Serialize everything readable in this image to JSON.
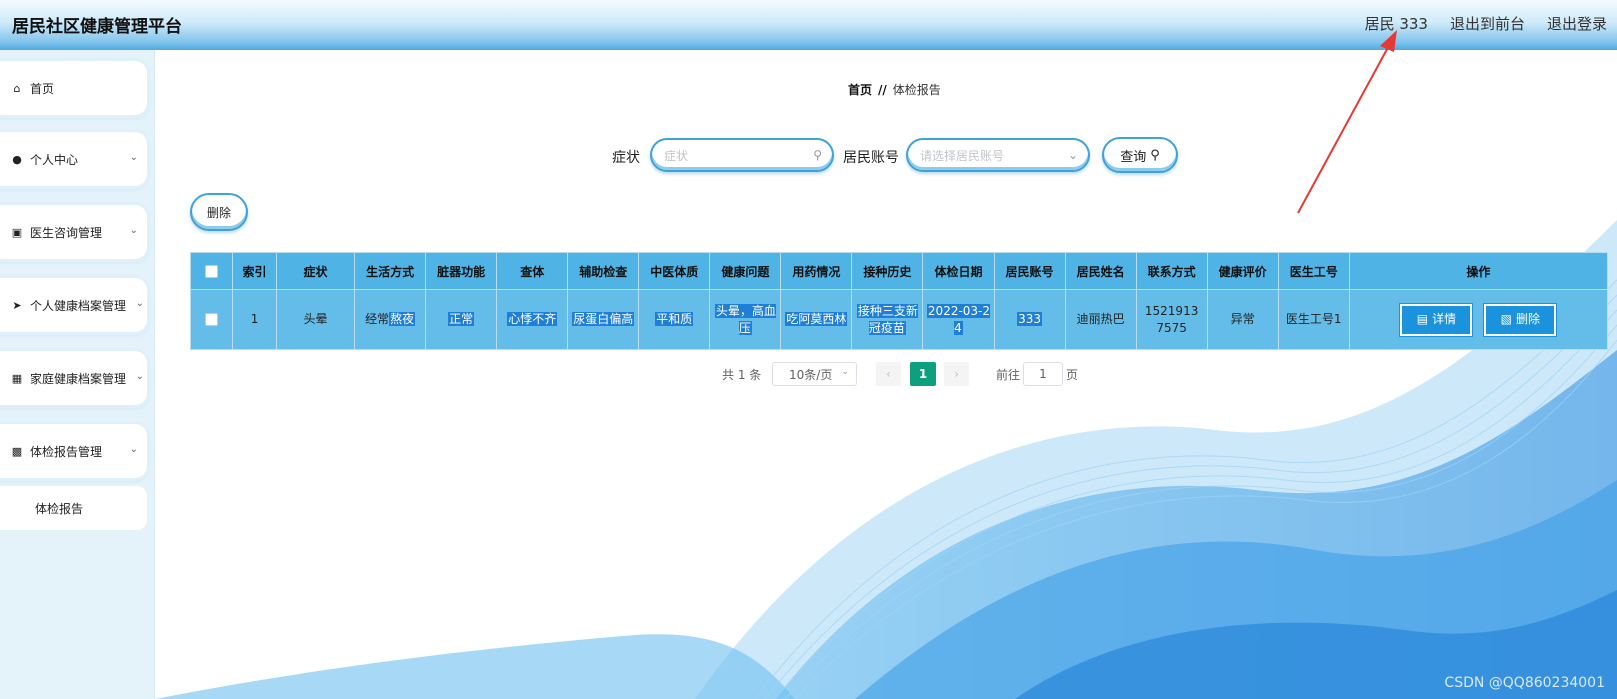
{
  "header": {
    "title": "居民社区健康管理平台",
    "user": "居民 333",
    "to_front": "退出到前台",
    "logout": "退出登录"
  },
  "sidebar": {
    "items": [
      {
        "label": "首页",
        "icon": "home-icon"
      },
      {
        "label": "个人中心",
        "icon": "user-icon"
      },
      {
        "label": "医生咨询管理",
        "icon": "monitor-icon"
      },
      {
        "label": "个人健康档案管理",
        "icon": "send-icon"
      },
      {
        "label": "家庭健康档案管理",
        "icon": "bar-chart-icon"
      },
      {
        "label": "体检报告管理",
        "icon": "grid-icon"
      }
    ],
    "subitem": "体检报告"
  },
  "breadcrumb": {
    "home": "首页",
    "sep": "//",
    "current": "体检报告"
  },
  "search": {
    "symptom_label": "症状",
    "symptom_placeholder": "症状",
    "account_label": "居民账号",
    "account_placeholder": "请选择居民账号",
    "query_label": "查询"
  },
  "toolbar": {
    "delete_label": "删除"
  },
  "table": {
    "headers": [
      "索引",
      "症状",
      "生活方式",
      "脏器功能",
      "查体",
      "辅助检查",
      "中医体质",
      "健康问题",
      "用药情况",
      "接种历史",
      "体检日期",
      "居民账号",
      "居民姓名",
      "联系方式",
      "健康评价",
      "医生工号",
      "操作"
    ],
    "rows": [
      {
        "index": "1",
        "symptom": "头晕",
        "lifestyle_a": "经常",
        "lifestyle_b": "熬夜",
        "organ": "正常",
        "exam": "心悸不齐",
        "aux_exam": "尿蛋白偏高",
        "tcm": "平和质",
        "health_issue": "头晕，高血压",
        "medication": "吃阿莫西林",
        "vaccination": "接种三支新冠疫苗",
        "date": "2022-03-24",
        "account": "333",
        "name": "迪丽热巴",
        "phone": "15219137575",
        "evaluation": "异常",
        "doctor_id": "医生工号1",
        "detail_label": "详情",
        "delete_label": "删除"
      }
    ]
  },
  "pagination": {
    "total": "共 1 条",
    "page_size": "10条/页",
    "current_page": "1",
    "goto_label": "前往",
    "goto_value": "1",
    "page_suffix": "页"
  },
  "watermark": "CSDN @QQ860234001",
  "colors": {
    "accent": "#4fb3e6",
    "row": "#64bde9",
    "button": "#1a93dc",
    "page_active": "#0ea07e",
    "annotation_arrow": "#e53935"
  }
}
